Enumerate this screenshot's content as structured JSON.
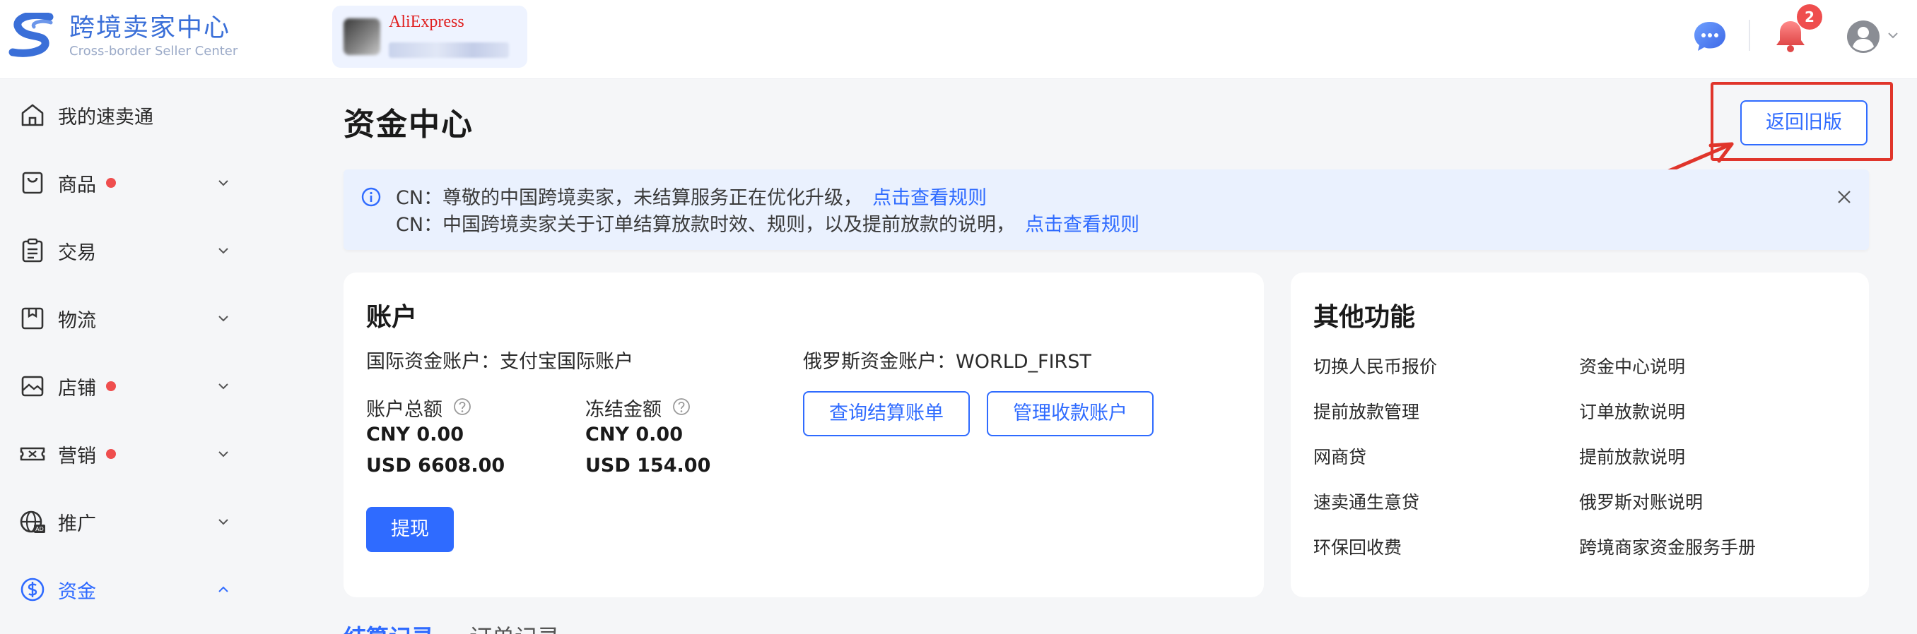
{
  "header": {
    "logo_title": "跨境卖家中心",
    "logo_subtitle": "Cross-border Seller Center",
    "store_brand": "AliExpress",
    "notification_count": "2",
    "brand_color": "#3a6fd8"
  },
  "sidebar": {
    "items": [
      {
        "label": "我的速卖通",
        "icon": "home-icon",
        "has_dot": false,
        "has_caret": false
      },
      {
        "label": "商品",
        "icon": "product-bag-icon",
        "has_dot": true,
        "has_caret": true
      },
      {
        "label": "交易",
        "icon": "clipboard-icon",
        "has_dot": false,
        "has_caret": true
      },
      {
        "label": "物流",
        "icon": "package-icon",
        "has_dot": false,
        "has_caret": true
      },
      {
        "label": "店铺",
        "icon": "store-image-icon",
        "has_dot": true,
        "has_caret": true
      },
      {
        "label": "营销",
        "icon": "ticket-icon",
        "has_dot": true,
        "has_caret": true
      },
      {
        "label": "推广",
        "icon": "globe-ad-icon",
        "has_dot": false,
        "has_caret": true
      },
      {
        "label": "资金",
        "icon": "dollar-circle-icon",
        "has_dot": false,
        "has_caret": true,
        "active": true
      }
    ]
  },
  "main": {
    "title": "资金中心",
    "old_version_button": "返回旧版",
    "notice": {
      "line1_text": "CN：尊敬的中国跨境卖家，未结算服务正在优化升级，",
      "line1_link": "点击查看规则",
      "line2_text": "CN：中国跨境卖家关于订单结算放款时效、规则，以及提前放款的说明，",
      "line2_link": "点击查看规则"
    },
    "account": {
      "title": "账户",
      "intl_account": "国际资金账户：支付宝国际账户",
      "ru_account": "俄罗斯资金账户：WORLD_FIRST",
      "total_label": "账户总额",
      "total_cny": "CNY 0.00",
      "total_usd": "USD 6608.00",
      "frozen_label": "冻结金额",
      "frozen_cny": "CNY 0.00",
      "frozen_usd": "USD 154.00",
      "query_bill_button": "查询结算账单",
      "manage_account_button": "管理收款账户",
      "withdraw_button": "提现"
    },
    "other_functions": {
      "title": "其他功能",
      "links": [
        "切换人民币报价",
        "资金中心说明",
        "提前放款管理",
        "订单放款说明",
        "网商贷",
        "提前放款说明",
        "速卖通生意贷",
        "俄罗斯对账说明",
        "环保回收费",
        "跨境商家资金服务手册"
      ]
    },
    "tabs": [
      "结算记录",
      "订单记录"
    ]
  },
  "colors": {
    "accent": "#2f6bff",
    "alert_red": "#ef4e4e",
    "annotation_red": "#e0352b",
    "notice_bg": "#eaf1fe"
  }
}
